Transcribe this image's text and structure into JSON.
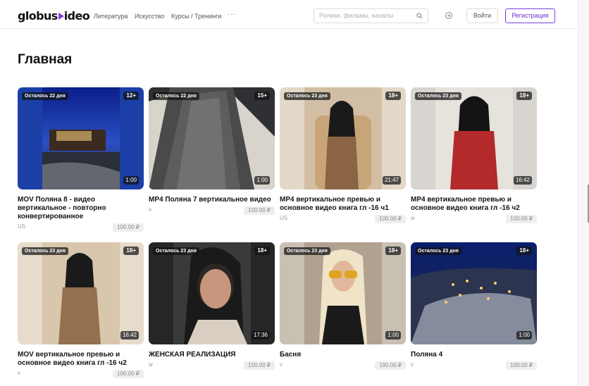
{
  "header": {
    "logo_left": "globus",
    "logo_right": "ideo",
    "nav": [
      "Литература",
      "Искусство",
      "Курсы / Тренинги"
    ],
    "more": "···",
    "search_placeholder": "Ролики, фильмы, каналы",
    "login_label": "Войти",
    "register_label": "Регистрация"
  },
  "page": {
    "title": "Главная"
  },
  "colors": {
    "accent": "#7b3fe4",
    "price_bg": "#eeeeee"
  },
  "cards": [
    {
      "days_left": "Осталось 22 дня",
      "age": "12+",
      "duration": "1:00",
      "title": "MOV Поляна 8 - видео вертикальное - повторно конвертированное",
      "meta": "US",
      "price": "100.00 ₽"
    },
    {
      "days_left": "Осталось 22 дня",
      "age": "15+",
      "duration": "1:00",
      "title": "MP4 Поляна 7 вертикальное видео",
      "meta": "v",
      "price": "100.00 ₽"
    },
    {
      "days_left": "Осталось 23 дня",
      "age": "18+",
      "duration": "21:47",
      "title": "MP4 вертикальное превью и основное видео книга гл -16 ч1",
      "meta": "US",
      "price": "100.00 ₽"
    },
    {
      "days_left": "Осталось 23 дня",
      "age": "18+",
      "duration": "16:42",
      "title": "MP4 вертикальное превью и основное видео книга гл -16 ч2",
      "meta": "w",
      "price": "100.00 ₽"
    },
    {
      "days_left": "Осталось 23 дня",
      "age": "18+",
      "duration": "16:42",
      "title": "MOV вертикальное превью и основное видео книга гл -16 ч2",
      "meta": "v",
      "price": "100.00 ₽"
    },
    {
      "days_left": "Осталось 23 дня",
      "age": "18+",
      "duration": "17:36",
      "title": "ЖЕНСКАЯ РЕАЛИЗАЦИЯ",
      "meta": "w",
      "price": "100.00 ₽"
    },
    {
      "days_left": "Осталось 23 дня",
      "age": "18+",
      "duration": "1:00",
      "title": "Басня",
      "meta": "v",
      "price": "190.00 ₽"
    },
    {
      "days_left": "Осталось 23 дня",
      "age": "18+",
      "duration": "1:00",
      "title": "Поляна 4",
      "meta": "v",
      "price": "100.00 ₽"
    }
  ]
}
